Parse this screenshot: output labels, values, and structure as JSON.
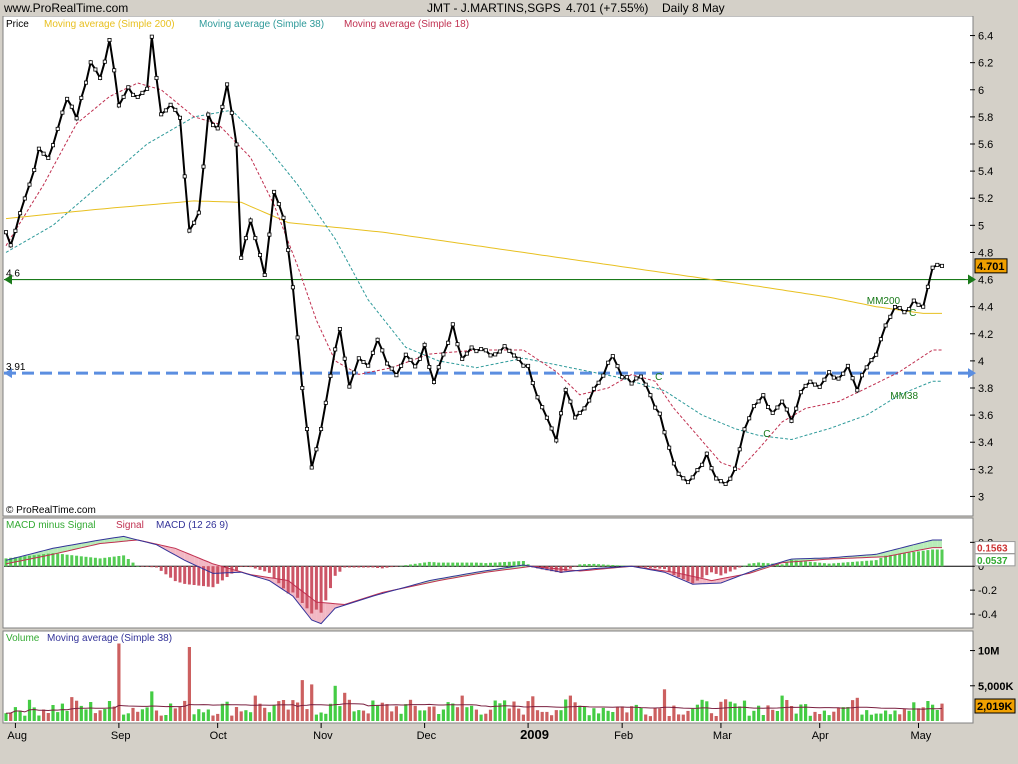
{
  "header": {
    "site": "www.ProRealTime.com",
    "symbol": "JMT - J.MARTINS,SGPS",
    "last_quote": "4.701 (+7.55%)",
    "period": "Daily 8 May"
  },
  "copyright": "© ProRealTime.com",
  "colors": {
    "price": "#000000",
    "ma200": "#e8c020",
    "ma38": "#2e9a9a",
    "ma18": "#c03050",
    "support": "#1a7a1a",
    "resistance": "#5b8ee0",
    "macd_pos": "#55cc55",
    "macd_neg": "#cc5566",
    "volume_up": "#44cc44",
    "volume_down": "#cc6060"
  },
  "chart_data": [
    {
      "type": "line",
      "panel": "price",
      "legend": [
        {
          "label": "Price",
          "color": "#000000"
        },
        {
          "label": "Moving average (Simple 200)",
          "color": "#e8c020"
        },
        {
          "label": "Moving average (Simple 38)",
          "color": "#2e9a9a"
        },
        {
          "label": "Moving average (Simple 18)",
          "color": "#c03050"
        }
      ],
      "ylim": [
        2.9,
        6.5
      ],
      "yticks": [
        3,
        3.2,
        3.4,
        3.6,
        3.8,
        4,
        4.2,
        4.4,
        4.6,
        4.8,
        5,
        5.2,
        5.4,
        5.6,
        5.8,
        6,
        6.2,
        6.4
      ],
      "ytick_labels": [
        "3",
        "3.2",
        "3.4",
        "3.6",
        "3.8",
        "4",
        "4.2",
        "4.4",
        "4.6",
        "4.8",
        "5",
        "5.2",
        "5.4",
        "5.6",
        "5.8",
        "6",
        "6.2",
        "6.4"
      ],
      "x_labels": [
        "Aug",
        "Sep",
        "Oct",
        "Nov",
        "Dec",
        "2009",
        "Feb",
        "Mar",
        "Apr",
        "May"
      ],
      "x_label_index": [
        2,
        24,
        45,
        67,
        89,
        111,
        131,
        152,
        173,
        194
      ],
      "x_count": 200,
      "last_value_label": "4.701",
      "hlines": [
        {
          "value": 4.6,
          "label": "4.6",
          "style": "solid",
          "color": "#1a7a1a"
        },
        {
          "value": 3.91,
          "label": "3.91",
          "style": "dashed",
          "color": "#5b8ee0"
        }
      ],
      "annotations": [
        {
          "text": "MM200",
          "index": 183,
          "value": 4.42
        },
        {
          "text": "C",
          "index": 192,
          "value": 4.33
        },
        {
          "text": "MM38",
          "index": 188,
          "value": 3.72
        },
        {
          "text": "C",
          "index": 161,
          "value": 3.44
        },
        {
          "text": "C",
          "index": 138,
          "value": 3.86
        }
      ],
      "price_keypoints": [
        [
          0,
          4.95
        ],
        [
          1,
          4.85
        ],
        [
          3,
          5.1
        ],
        [
          5,
          5.3
        ],
        [
          7,
          5.55
        ],
        [
          9,
          5.5
        ],
        [
          11,
          5.7
        ],
        [
          13,
          5.95
        ],
        [
          15,
          5.8
        ],
        [
          18,
          6.2
        ],
        [
          20,
          6.1
        ],
        [
          22,
          6.35
        ],
        [
          24,
          5.9
        ],
        [
          26,
          6.0
        ],
        [
          28,
          5.95
        ],
        [
          30,
          6.0
        ],
        [
          31,
          6.4
        ],
        [
          33,
          5.8
        ],
        [
          35,
          5.9
        ],
        [
          37,
          5.8
        ],
        [
          39,
          4.95
        ],
        [
          41,
          5.1
        ],
        [
          43,
          5.8
        ],
        [
          45,
          5.7
        ],
        [
          47,
          6.05
        ],
        [
          49,
          5.6
        ],
        [
          50,
          4.75
        ],
        [
          52,
          5.05
        ],
        [
          55,
          4.65
        ],
        [
          57,
          5.25
        ],
        [
          59,
          5.05
        ],
        [
          61,
          4.55
        ],
        [
          63,
          3.8
        ],
        [
          65,
          3.2
        ],
        [
          67,
          3.5
        ],
        [
          69,
          3.9
        ],
        [
          71,
          4.25
        ],
        [
          73,
          3.8
        ],
        [
          75,
          4.0
        ],
        [
          77,
          3.95
        ],
        [
          79,
          4.15
        ],
        [
          81,
          4.0
        ],
        [
          83,
          3.9
        ],
        [
          85,
          4.05
        ],
        [
          87,
          3.95
        ],
        [
          89,
          4.1
        ],
        [
          91,
          3.85
        ],
        [
          93,
          4.05
        ],
        [
          95,
          4.25
        ],
        [
          97,
          4.0
        ],
        [
          99,
          4.1
        ],
        [
          103,
          4.05
        ],
        [
          106,
          4.1
        ],
        [
          109,
          4.0
        ],
        [
          111,
          3.95
        ],
        [
          113,
          3.75
        ],
        [
          115,
          3.6
        ],
        [
          117,
          3.4
        ],
        [
          119,
          3.8
        ],
        [
          121,
          3.6
        ],
        [
          123,
          3.65
        ],
        [
          125,
          3.8
        ],
        [
          127,
          3.9
        ],
        [
          129,
          4.05
        ],
        [
          131,
          3.9
        ],
        [
          133,
          3.85
        ],
        [
          135,
          3.9
        ],
        [
          137,
          3.75
        ],
        [
          139,
          3.6
        ],
        [
          141,
          3.35
        ],
        [
          143,
          3.15
        ],
        [
          145,
          3.1
        ],
        [
          147,
          3.2
        ],
        [
          149,
          3.3
        ],
        [
          151,
          3.15
        ],
        [
          153,
          3.1
        ],
        [
          155,
          3.2
        ],
        [
          157,
          3.5
        ],
        [
          159,
          3.65
        ],
        [
          161,
          3.75
        ],
        [
          163,
          3.6
        ],
        [
          165,
          3.7
        ],
        [
          167,
          3.55
        ],
        [
          169,
          3.75
        ],
        [
          171,
          3.85
        ],
        [
          173,
          3.8
        ],
        [
          175,
          3.9
        ],
        [
          177,
          3.85
        ],
        [
          179,
          3.95
        ],
        [
          181,
          3.8
        ],
        [
          183,
          3.95
        ],
        [
          185,
          4.05
        ],
        [
          187,
          4.25
        ],
        [
          189,
          4.4
        ],
        [
          191,
          4.35
        ],
        [
          193,
          4.45
        ],
        [
          195,
          4.38
        ],
        [
          197,
          4.701
        ]
      ],
      "ma200_keypoints": [
        [
          0,
          5.05
        ],
        [
          20,
          5.12
        ],
        [
          40,
          5.18
        ],
        [
          50,
          5.17
        ],
        [
          60,
          5.02
        ],
        [
          80,
          4.95
        ],
        [
          100,
          4.85
        ],
        [
          120,
          4.75
        ],
        [
          140,
          4.65
        ],
        [
          160,
          4.55
        ],
        [
          175,
          4.47
        ],
        [
          185,
          4.4
        ],
        [
          195,
          4.35
        ]
      ],
      "ma38_keypoints": [
        [
          0,
          4.8
        ],
        [
          10,
          5.0
        ],
        [
          20,
          5.3
        ],
        [
          30,
          5.6
        ],
        [
          40,
          5.8
        ],
        [
          48,
          5.85
        ],
        [
          55,
          5.6
        ],
        [
          62,
          5.3
        ],
        [
          70,
          4.9
        ],
        [
          77,
          4.45
        ],
        [
          85,
          4.1
        ],
        [
          92,
          4.0
        ],
        [
          100,
          3.95
        ],
        [
          110,
          4.02
        ],
        [
          120,
          3.95
        ],
        [
          130,
          3.88
        ],
        [
          140,
          3.78
        ],
        [
          148,
          3.6
        ],
        [
          155,
          3.5
        ],
        [
          160,
          3.45
        ],
        [
          167,
          3.42
        ],
        [
          175,
          3.5
        ],
        [
          183,
          3.6
        ],
        [
          190,
          3.75
        ],
        [
          197,
          3.85
        ]
      ],
      "ma18_keypoints": [
        [
          0,
          4.85
        ],
        [
          8,
          5.3
        ],
        [
          15,
          5.75
        ],
        [
          22,
          5.95
        ],
        [
          28,
          6.05
        ],
        [
          33,
          6.0
        ],
        [
          40,
          5.8
        ],
        [
          45,
          5.75
        ],
        [
          52,
          5.5
        ],
        [
          57,
          5.15
        ],
        [
          62,
          4.7
        ],
        [
          66,
          4.3
        ],
        [
          70,
          4.0
        ],
        [
          75,
          3.9
        ],
        [
          82,
          3.95
        ],
        [
          90,
          4.05
        ],
        [
          100,
          4.08
        ],
        [
          110,
          4.08
        ],
        [
          117,
          3.92
        ],
        [
          122,
          3.75
        ],
        [
          128,
          3.8
        ],
        [
          133,
          3.9
        ],
        [
          138,
          3.85
        ],
        [
          142,
          3.65
        ],
        [
          147,
          3.45
        ],
        [
          152,
          3.25
        ],
        [
          156,
          3.2
        ],
        [
          160,
          3.35
        ],
        [
          165,
          3.55
        ],
        [
          170,
          3.65
        ],
        [
          177,
          3.7
        ],
        [
          183,
          3.8
        ],
        [
          190,
          3.92
        ],
        [
          197,
          4.08
        ]
      ]
    },
    {
      "type": "area",
      "panel": "macd",
      "legend": [
        {
          "label": "MACD minus Signal",
          "color": "#33aa33"
        },
        {
          "label": "Signal",
          "color": "#c03050"
        },
        {
          "label": "MACD (12 26 9)",
          "color": "#333399"
        }
      ],
      "ylim": [
        -0.5,
        0.32
      ],
      "yticks": [
        0.2,
        0,
        -0.2,
        -0.4
      ],
      "ytick_labels": [
        "0.2",
        "0",
        "-0.2",
        "-0.4"
      ],
      "value_labels": [
        {
          "text": "0.1563",
          "value": 0.1563,
          "color": "#cc3333"
        },
        {
          "text": "0.0537",
          "value": 0.0537,
          "color": "#33aa33"
        }
      ],
      "macd_keypoints": [
        [
          0,
          0.05
        ],
        [
          10,
          0.15
        ],
        [
          20,
          0.22
        ],
        [
          25,
          0.25
        ],
        [
          32,
          0.18
        ],
        [
          38,
          0.05
        ],
        [
          44,
          -0.06
        ],
        [
          50,
          -0.05
        ],
        [
          56,
          -0.12
        ],
        [
          61,
          -0.25
        ],
        [
          65,
          -0.45
        ],
        [
          67,
          -0.48
        ],
        [
          70,
          -0.35
        ],
        [
          78,
          -0.25
        ],
        [
          90,
          -0.12
        ],
        [
          100,
          -0.05
        ],
        [
          110,
          0.01
        ],
        [
          118,
          -0.05
        ],
        [
          125,
          -0.02
        ],
        [
          133,
          0.0
        ],
        [
          140,
          -0.05
        ],
        [
          146,
          -0.15
        ],
        [
          152,
          -0.14
        ],
        [
          160,
          -0.02
        ],
        [
          167,
          0.06
        ],
        [
          175,
          0.07
        ],
        [
          185,
          0.1
        ],
        [
          197,
          0.22
        ]
      ],
      "signal_keypoints": [
        [
          0,
          0.02
        ],
        [
          10,
          0.1
        ],
        [
          20,
          0.19
        ],
        [
          28,
          0.22
        ],
        [
          36,
          0.15
        ],
        [
          44,
          0.02
        ],
        [
          52,
          -0.07
        ],
        [
          60,
          -0.12
        ],
        [
          66,
          -0.3
        ],
        [
          72,
          -0.32
        ],
        [
          80,
          -0.22
        ],
        [
          92,
          -0.12
        ],
        [
          102,
          -0.05
        ],
        [
          112,
          0.0
        ],
        [
          122,
          -0.04
        ],
        [
          133,
          0.0
        ],
        [
          142,
          -0.05
        ],
        [
          150,
          -0.12
        ],
        [
          158,
          -0.06
        ],
        [
          165,
          0.03
        ],
        [
          175,
          0.06
        ],
        [
          187,
          0.08
        ],
        [
          197,
          0.1563
        ]
      ]
    },
    {
      "type": "bar",
      "panel": "volume",
      "legend": [
        {
          "label": "Volume",
          "color": "#33aa33"
        },
        {
          "label": "Moving average (Simple 38)",
          "color": "#333399"
        }
      ],
      "ylim": [
        0,
        11500
      ],
      "yticks": [
        10000,
        5000
      ],
      "ytick_labels": [
        "10M",
        "5,000K"
      ],
      "last_value_label": "2,019K",
      "volume_spikes": [
        [
          24,
          11000
        ],
        [
          39,
          10500
        ],
        [
          63,
          5800
        ],
        [
          70,
          5000
        ],
        [
          31,
          4200
        ],
        [
          140,
          4500
        ],
        [
          120,
          3600
        ],
        [
          112,
          3500
        ],
        [
          165,
          3600
        ],
        [
          97,
          3600
        ],
        [
          53,
          3600
        ],
        [
          14,
          3400
        ],
        [
          181,
          3300
        ],
        [
          72,
          4000
        ],
        [
          65,
          5200
        ]
      ],
      "volume_ma_level": 2400
    }
  ]
}
